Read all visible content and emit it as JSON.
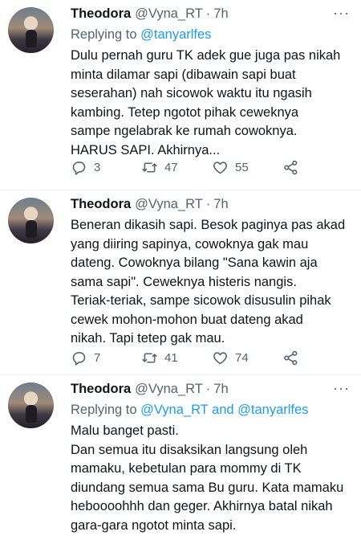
{
  "tweets": [
    {
      "name": "Theodora",
      "handle": "@Vyna_RT",
      "time": "7h",
      "reply_prefix": "Replying to ",
      "reply_to": "@tanyarlfes",
      "text": "Dulu pernah guru TK adek gue juga pas nikah\nminta dilamar sapi (dibawain sapi buat\nseserahan) nah sicowok waktu itu ngasih\nkambing. Tetep ngotot pihak ceweknya\nsampe ngelabrak ke rumah cowoknya.\nHARUS SAPI. Akhirnya...",
      "replies": "3",
      "retweets": "47",
      "likes": "55"
    },
    {
      "name": "Theodora",
      "handle": "@Vyna_RT",
      "time": "7h",
      "text": "Beneran dikasih sapi. Besok paginya pas akad\nyang diiring sapinya, cowoknya gak mau\ndateng. Cowoknya bilang \"Sana kawin aja\nsama sapi\". Ceweknya histeris nangis.\nTeriak-teriak, sampe sicowok disusulin pihak\ncewek mohon-mohon buat dateng akad\nnikah. Tapi tetep gak mau.",
      "replies": "7",
      "retweets": "41",
      "likes": "74"
    },
    {
      "name": "Theodora",
      "handle": "@Vyna_RT",
      "time": "7h",
      "reply_prefix": "Replying to ",
      "reply_to": "@Vyna_RT and @tanyarlfes",
      "text": "Malu banget pasti.\nDan semua itu disaksikan langsung oleh\nmamaku, kebetulan para mommy di TK\ndiundang semua sama Bu guru. Kata mamaku\nheboooohhh dan geger. Akhirnya batal nikah\ngara-gara ngotot minta sapi."
    }
  ],
  "icons": {
    "reply": "reply-icon",
    "retweet": "retweet-icon",
    "like": "heart-icon",
    "share": "share-icon",
    "more": "more-icon"
  },
  "colors": {
    "text": "#0f1419",
    "secondary": "#536471",
    "link": "#1d9bf0",
    "divider": "#eff3f4"
  }
}
